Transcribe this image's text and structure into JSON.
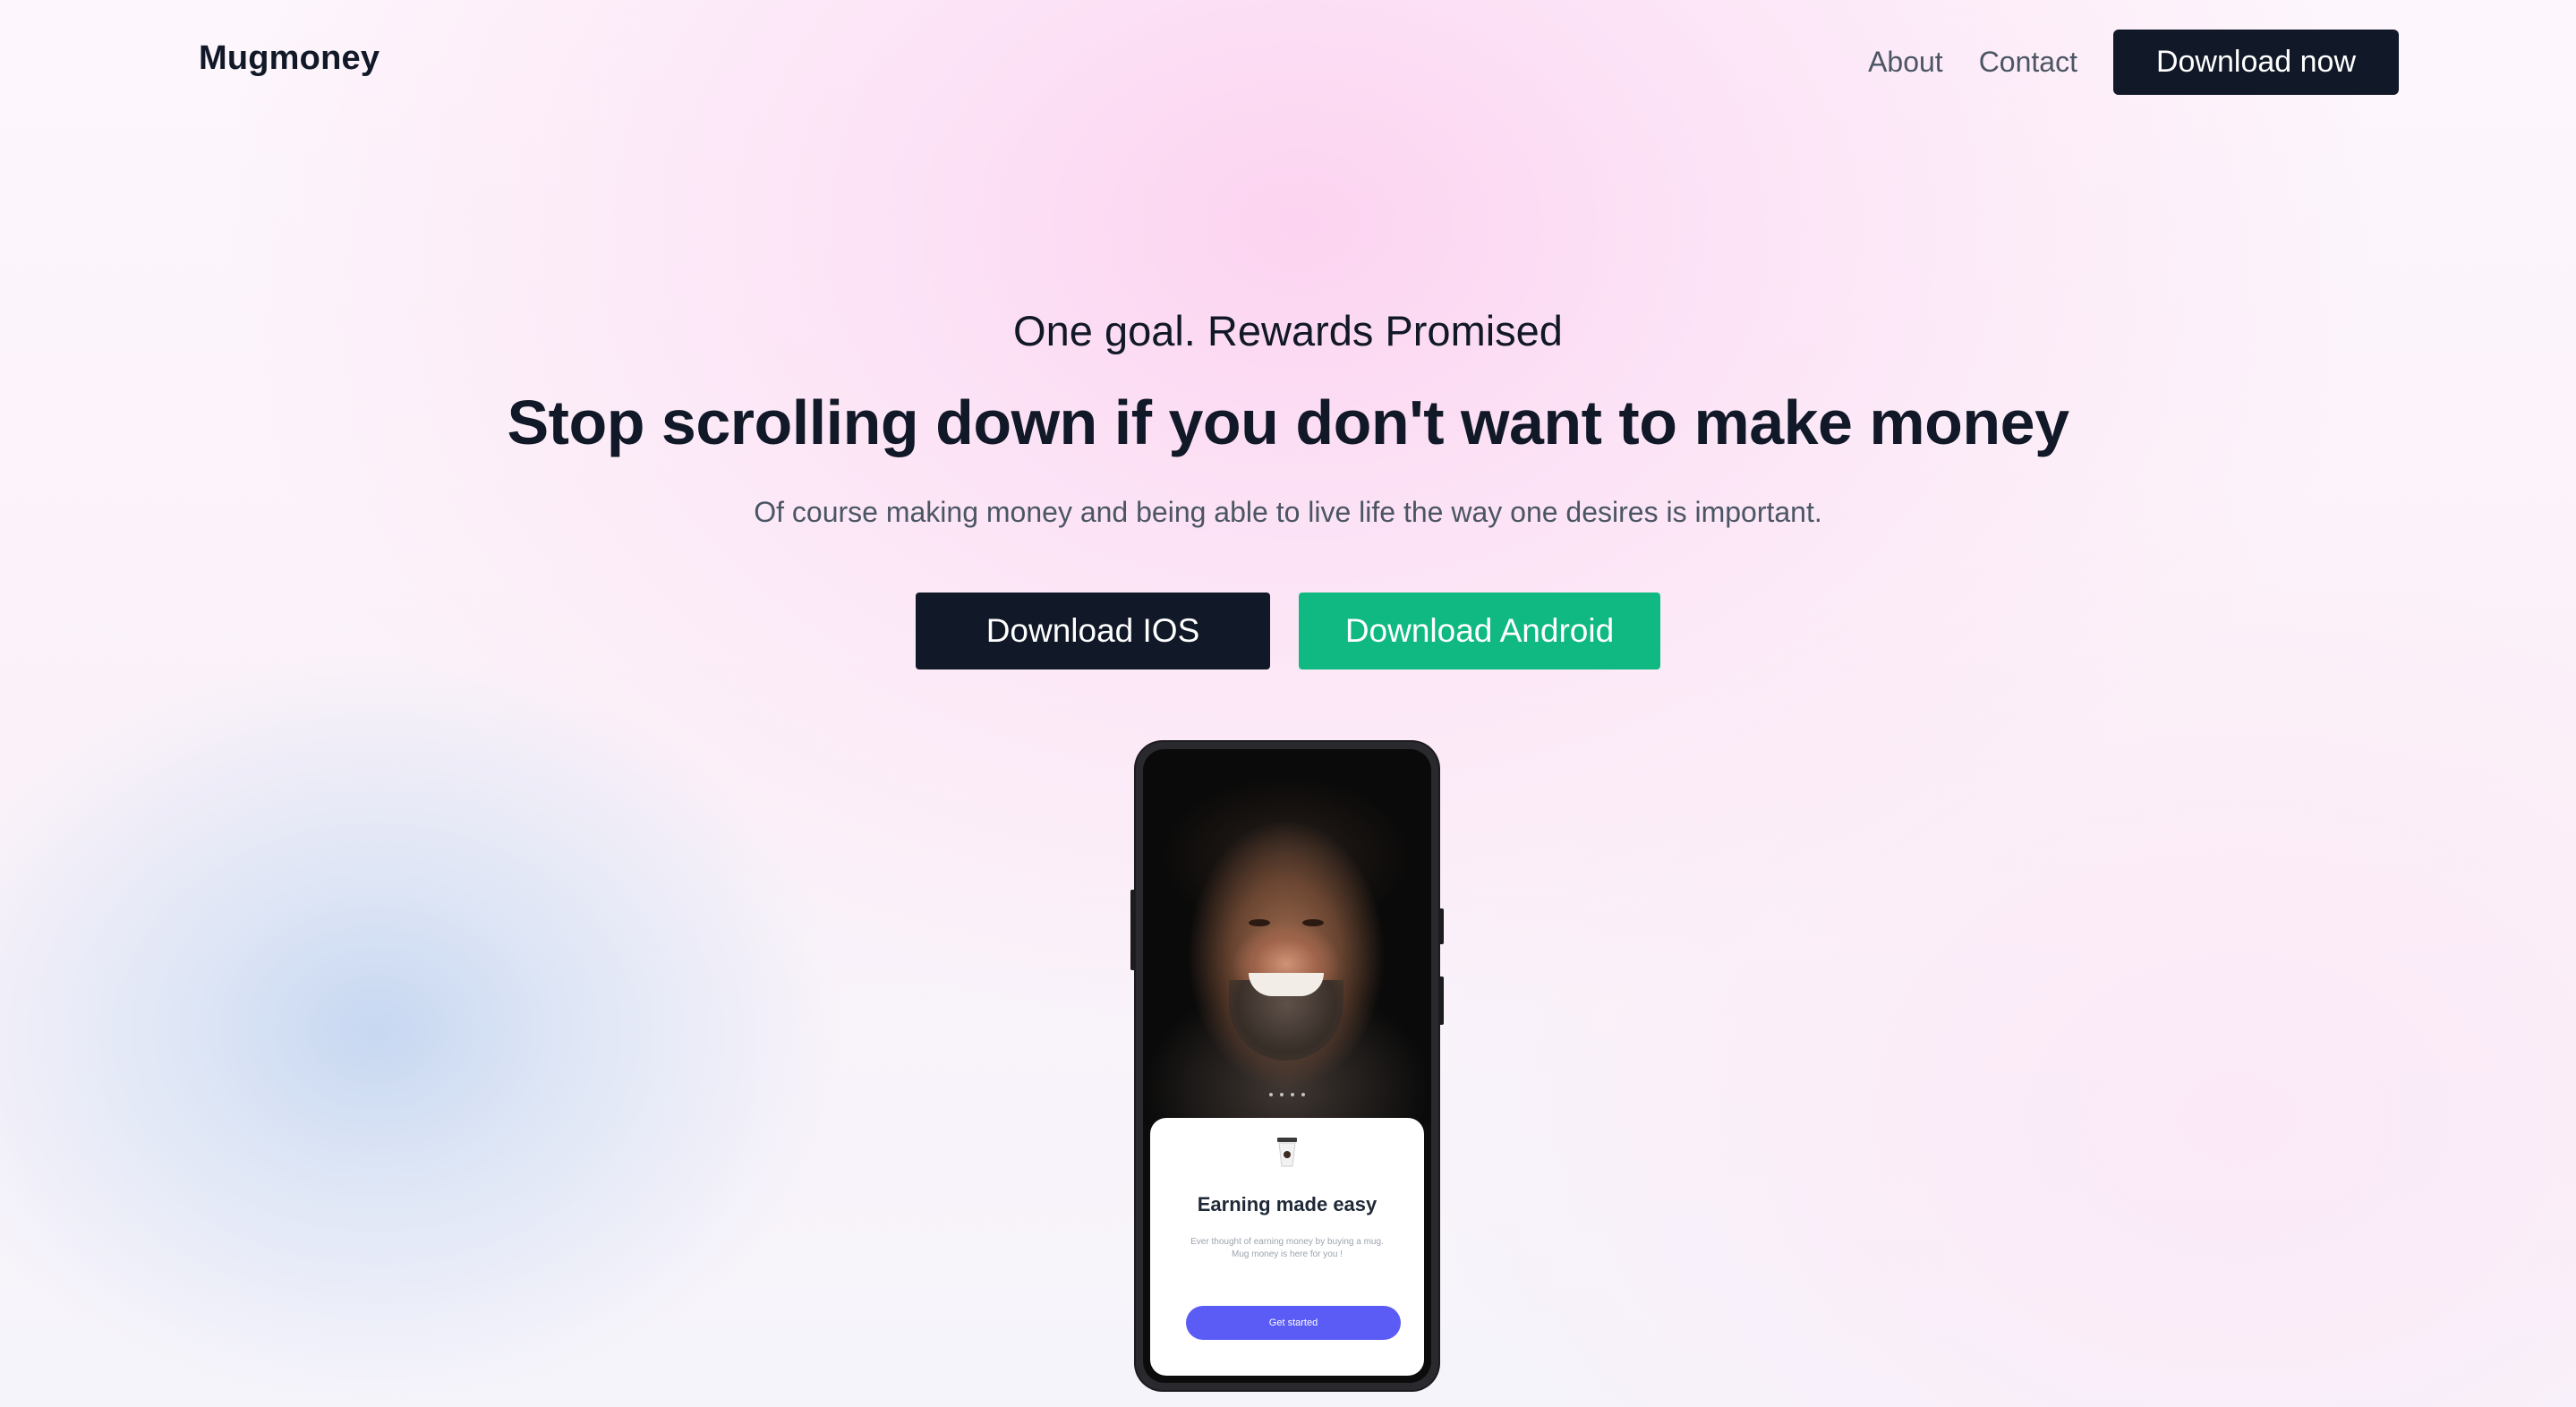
{
  "nav": {
    "brand": "Mugmoney",
    "links": [
      "About",
      "Contact"
    ],
    "cta": "Download now"
  },
  "hero": {
    "eyebrow": "One goal. Rewards Promised",
    "headline": "Stop scrolling down if you don't want to make money",
    "subheadline": "Of course making money and being able to live life the way one desires is important.",
    "buttons": {
      "ios": "Download IOS",
      "android": "Download Android"
    }
  },
  "phone": {
    "card": {
      "title": "Earning made easy",
      "text": "Ever thought of earning money by buying a mug. Mug money is here for you !",
      "button": "Get started"
    }
  },
  "colors": {
    "dark": "#111827",
    "android_green": "#10b981",
    "card_button": "#5b5bf5"
  }
}
